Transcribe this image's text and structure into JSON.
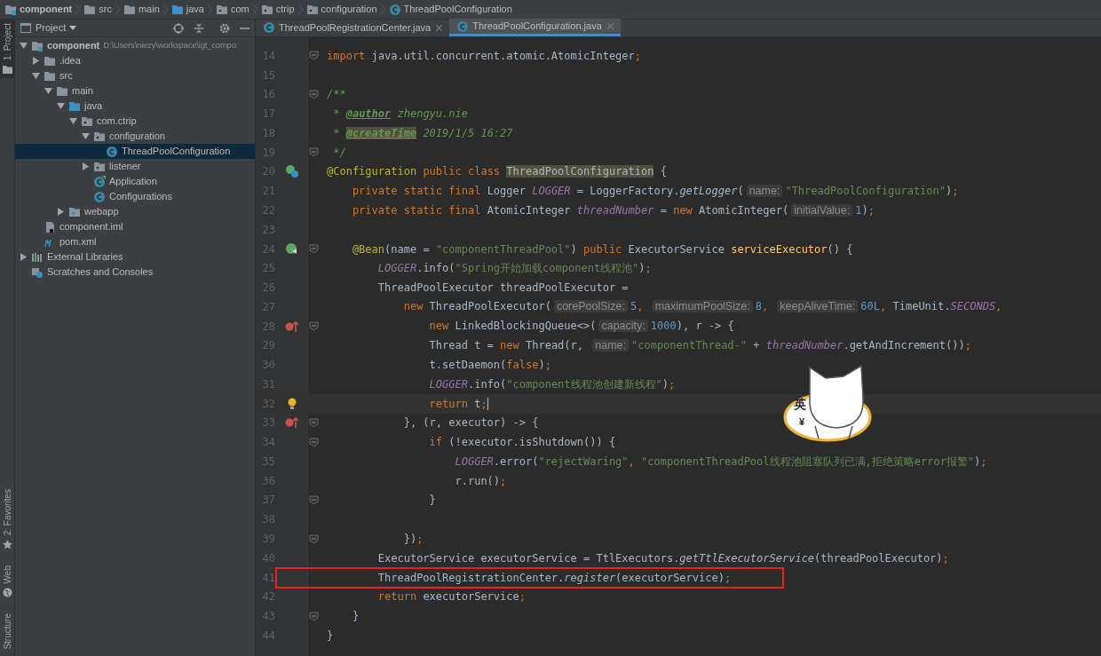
{
  "breadcrumb": [
    {
      "label": "component",
      "kind": "module"
    },
    {
      "label": "src",
      "kind": "folder"
    },
    {
      "label": "main",
      "kind": "folder"
    },
    {
      "label": "java",
      "kind": "source"
    },
    {
      "label": "com",
      "kind": "package"
    },
    {
      "label": "ctrip",
      "kind": "package"
    },
    {
      "label": "configuration",
      "kind": "package"
    },
    {
      "label": "ThreadPoolConfiguration",
      "kind": "class"
    }
  ],
  "tool_strip": {
    "top": [
      {
        "label": "1: Project",
        "kind": "project",
        "selected": true
      }
    ],
    "bottom": [
      {
        "label": "2: Favorites",
        "kind": "favorites",
        "selected": false
      },
      {
        "label": "Web",
        "kind": "web",
        "selected": false
      },
      {
        "label": "Structure",
        "kind": "structure",
        "selected": false
      }
    ]
  },
  "project_panel": {
    "title": "Project",
    "tree": [
      {
        "label": "component",
        "path": "D:\\Users\\niezy\\workspace\\igt_compo",
        "kind": "module",
        "expanded": true,
        "selected": false,
        "children": [
          {
            "label": ".idea",
            "kind": "folder",
            "expanded": false,
            "selected": false
          },
          {
            "label": "src",
            "kind": "folder",
            "expanded": true,
            "selected": false,
            "children": [
              {
                "label": "main",
                "kind": "folder",
                "expanded": true,
                "selected": false,
                "children": [
                  {
                    "label": "java",
                    "kind": "source",
                    "expanded": true,
                    "selected": false,
                    "children": [
                      {
                        "label": "com.ctrip",
                        "kind": "package",
                        "expanded": true,
                        "selected": false,
                        "children": [
                          {
                            "label": "configuration",
                            "kind": "package",
                            "expanded": true,
                            "selected": false,
                            "children": [
                              {
                                "label": "ThreadPoolConfiguration",
                                "kind": "class",
                                "selected": true
                              }
                            ]
                          },
                          {
                            "label": "listener",
                            "kind": "package",
                            "expanded": false,
                            "selected": false
                          },
                          {
                            "label": "Application",
                            "kind": "app",
                            "selected": false
                          },
                          {
                            "label": "Configurations",
                            "kind": "class",
                            "selected": false
                          }
                        ]
                      }
                    ]
                  },
                  {
                    "label": "webapp",
                    "kind": "web",
                    "expanded": false,
                    "selected": false
                  }
                ]
              }
            ]
          },
          {
            "label": "component.iml",
            "kind": "iml",
            "selected": false
          },
          {
            "label": "pom.xml",
            "kind": "maven",
            "selected": false
          }
        ]
      },
      {
        "label": "External Libraries",
        "kind": "libraries",
        "expanded": false,
        "selected": false
      },
      {
        "label": "Scratches and Consoles",
        "kind": "scratches",
        "selected": false
      }
    ]
  },
  "tabs": [
    {
      "label": "ThreadPoolRegistrationCenter.java",
      "selected": false
    },
    {
      "label": "ThreadPoolConfiguration.java",
      "selected": true
    }
  ],
  "code_lines": [
    {
      "number": "14",
      "fold": true,
      "tokens": [
        {
          "kind": "kw",
          "text": "import "
        },
        {
          "kind": "plain",
          "text": "java.util.concurrent.atomic.AtomicInteger"
        },
        {
          "kind": "kw",
          "text": ";"
        }
      ]
    },
    {
      "number": "15"
    },
    {
      "number": "16",
      "fold": true,
      "tokens": [
        {
          "kind": "doc",
          "text": "/**"
        }
      ]
    },
    {
      "number": "17",
      "tokens": [
        {
          "kind": "doc",
          "text": " * "
        },
        {
          "kind": "doctag",
          "text": "@author"
        },
        {
          "kind": "doc",
          "text": " zhengyu.nie"
        }
      ]
    },
    {
      "number": "18",
      "tokens": [
        {
          "kind": "doc",
          "text": " * "
        },
        {
          "kind": "doctag_usage",
          "text": "@createTime"
        },
        {
          "kind": "doc",
          "text": " 2019/1/5 16:27"
        }
      ]
    },
    {
      "number": "19",
      "fold": true,
      "tokens": [
        {
          "kind": "doc",
          "text": " */"
        }
      ]
    },
    {
      "number": "20",
      "gutter_icon": {
        "kind": "bean"
      },
      "tokens": [
        {
          "kind": "ann",
          "text": "@Configuration"
        },
        {
          "kind": "kw",
          "text": " public class "
        },
        {
          "kind": "usage",
          "text": "ThreadPoolConfiguration"
        },
        {
          "kind": "plain",
          "text": " {"
        }
      ]
    },
    {
      "number": "21",
      "tokens": [
        {
          "kind": "kw",
          "text": "    private static final "
        },
        {
          "kind": "plain",
          "text": "Logger "
        },
        {
          "kind": "field",
          "text": "LOGGER"
        },
        {
          "kind": "plain",
          "text": " = LoggerFactory."
        },
        {
          "kind": "static",
          "text": "getLogger"
        },
        {
          "kind": "plain",
          "text": "("
        },
        {
          "kind": "hint",
          "text": "name:"
        },
        {
          "kind": "str",
          "text": "\"ThreadPoolConfiguration\""
        },
        {
          "kind": "plain",
          "text": ")"
        },
        {
          "kind": "kw",
          "text": ";"
        }
      ]
    },
    {
      "number": "22",
      "tokens": [
        {
          "kind": "kw",
          "text": "    private static final "
        },
        {
          "kind": "plain",
          "text": "AtomicInteger "
        },
        {
          "kind": "field",
          "text": "threadNumber"
        },
        {
          "kind": "plain",
          "text": " = "
        },
        {
          "kind": "kw",
          "text": "new "
        },
        {
          "kind": "plain",
          "text": "AtomicInteger("
        },
        {
          "kind": "hint",
          "text": "initialValue:"
        },
        {
          "kind": "num",
          "text": "1"
        },
        {
          "kind": "plain",
          "text": ")"
        },
        {
          "kind": "kw",
          "text": ";"
        }
      ]
    },
    {
      "number": "23"
    },
    {
      "number": "24",
      "fold": true,
      "gutter_icon": {
        "kind": "bean_method"
      },
      "tokens": [
        {
          "kind": "ann",
          "text": "    @Bean"
        },
        {
          "kind": "plain",
          "text": "(name = "
        },
        {
          "kind": "str",
          "text": "\"componentThreadPool\""
        },
        {
          "kind": "plain",
          "text": ") "
        },
        {
          "kind": "kw",
          "text": "public "
        },
        {
          "kind": "plain",
          "text": "ExecutorService "
        },
        {
          "kind": "decl",
          "text": "serviceExecutor"
        },
        {
          "kind": "plain",
          "text": "() {"
        }
      ]
    },
    {
      "number": "25",
      "tokens": [
        {
          "kind": "field",
          "text": "        LOGGER"
        },
        {
          "kind": "plain",
          "text": ".info("
        },
        {
          "kind": "str",
          "text": "\"Spring开始加载component线程池\""
        },
        {
          "kind": "plain",
          "text": ")"
        },
        {
          "kind": "kw",
          "text": ";"
        }
      ]
    },
    {
      "number": "26",
      "tokens": [
        {
          "kind": "plain",
          "text": "        ThreadPoolExecutor threadPoolExecutor ="
        }
      ]
    },
    {
      "number": "27",
      "tokens": [
        {
          "kind": "kw",
          "text": "            new "
        },
        {
          "kind": "plain",
          "text": "ThreadPoolExecutor("
        },
        {
          "kind": "hint",
          "text": "corePoolSize:"
        },
        {
          "kind": "num",
          "text": "5"
        },
        {
          "kind": "kw",
          "text": ", "
        },
        {
          "kind": "hint",
          "text": "maximumPoolSize:"
        },
        {
          "kind": "num",
          "text": "8"
        },
        {
          "kind": "kw",
          "text": ", "
        },
        {
          "kind": "hint",
          "text": "keepAliveTime:"
        },
        {
          "kind": "num",
          "text": "60L"
        },
        {
          "kind": "kw",
          "text": ", "
        },
        {
          "kind": "plain",
          "text": "TimeUnit."
        },
        {
          "kind": "field",
          "text": "SECONDS"
        },
        {
          "kind": "kw",
          "text": ","
        }
      ]
    },
    {
      "number": "28",
      "fold": true,
      "gutter_icon": {
        "kind": "lambda"
      },
      "tokens": [
        {
          "kind": "kw",
          "text": "                new "
        },
        {
          "kind": "plain",
          "text": "LinkedBlockingQueue<>("
        },
        {
          "kind": "hint",
          "text": "capacity:"
        },
        {
          "kind": "num",
          "text": "1000"
        },
        {
          "kind": "plain",
          "text": "), r -> {"
        }
      ]
    },
    {
      "number": "29",
      "tokens": [
        {
          "kind": "plain",
          "text": "                Thread t = "
        },
        {
          "kind": "kw",
          "text": "new "
        },
        {
          "kind": "plain",
          "text": "Thread(r, "
        },
        {
          "kind": "hint",
          "text": "name:"
        },
        {
          "kind": "str",
          "text": "\"componentThread-\""
        },
        {
          "kind": "plain",
          "text": " + "
        },
        {
          "kind": "field",
          "text": "threadNumber"
        },
        {
          "kind": "plain",
          "text": ".getAndIncrement())"
        },
        {
          "kind": "kw",
          "text": ";"
        }
      ]
    },
    {
      "number": "30",
      "tokens": [
        {
          "kind": "plain",
          "text": "                t.setDaemon("
        },
        {
          "kind": "kw",
          "text": "false"
        },
        {
          "kind": "plain",
          "text": ")"
        },
        {
          "kind": "kw",
          "text": ";"
        }
      ]
    },
    {
      "number": "31",
      "tokens": [
        {
          "kind": "field",
          "text": "                LOGGER"
        },
        {
          "kind": "plain",
          "text": ".info("
        },
        {
          "kind": "str",
          "text": "\"component线程池创建新线程\""
        },
        {
          "kind": "plain",
          "text": ")"
        },
        {
          "kind": "kw",
          "text": ";"
        }
      ]
    },
    {
      "number": "32",
      "current": true,
      "gutter_icon": {
        "kind": "bulb"
      },
      "tokens": [
        {
          "kind": "kw",
          "text": "                return "
        },
        {
          "kind": "plain",
          "text": "t"
        },
        {
          "kind": "kw",
          "text": ";"
        }
      ]
    },
    {
      "number": "33",
      "fold": true,
      "gutter_icon": {
        "kind": "lambda"
      },
      "tokens": [
        {
          "kind": "plain",
          "text": "            }, (r, executor) -> {"
        }
      ]
    },
    {
      "number": "34",
      "fold": true,
      "tokens": [
        {
          "kind": "kw",
          "text": "                if "
        },
        {
          "kind": "plain",
          "text": "(!executor.isShutdown()) {"
        }
      ]
    },
    {
      "number": "35",
      "tokens": [
        {
          "kind": "field",
          "text": "                    LOGGER"
        },
        {
          "kind": "plain",
          "text": ".error("
        },
        {
          "kind": "str",
          "text": "\"rejectWaring\""
        },
        {
          "kind": "kw",
          "text": ", "
        },
        {
          "kind": "str",
          "text": "\"componentThreadPool线程池阻塞队列已满,拒绝策略error报警\""
        },
        {
          "kind": "plain",
          "text": ")"
        },
        {
          "kind": "kw",
          "text": ";"
        }
      ]
    },
    {
      "number": "36",
      "tokens": [
        {
          "kind": "plain",
          "text": "                    r.run()"
        },
        {
          "kind": "kw",
          "text": ";"
        }
      ]
    },
    {
      "number": "37",
      "fold": true,
      "tokens": [
        {
          "kind": "plain",
          "text": "                }"
        }
      ]
    },
    {
      "number": "38"
    },
    {
      "number": "39",
      "fold": true,
      "tokens": [
        {
          "kind": "plain",
          "text": "            })"
        },
        {
          "kind": "kw",
          "text": ";"
        }
      ]
    },
    {
      "number": "40",
      "tokens": [
        {
          "kind": "plain",
          "text": "        ExecutorService executorService = TtlExecutors."
        },
        {
          "kind": "static",
          "text": "getTtlExecutorService"
        },
        {
          "kind": "plain",
          "text": "(threadPoolExecutor)"
        },
        {
          "kind": "kw",
          "text": ";"
        }
      ]
    },
    {
      "number": "41",
      "boxed": true,
      "tokens": [
        {
          "kind": "plain",
          "text": "        ThreadPoolRegistrationCenter."
        },
        {
          "kind": "static",
          "text": "register"
        },
        {
          "kind": "plain",
          "text": "(executorService)"
        },
        {
          "kind": "kw",
          "text": ";"
        }
      ]
    },
    {
      "number": "42",
      "tokens": [
        {
          "kind": "kw",
          "text": "        return "
        },
        {
          "kind": "plain",
          "text": "executorService"
        },
        {
          "kind": "kw",
          "text": ";"
        }
      ]
    },
    {
      "number": "43",
      "fold": true,
      "tokens": [
        {
          "kind": "plain",
          "text": "    }"
        }
      ]
    },
    {
      "number": "44",
      "tokens": [
        {
          "kind": "plain",
          "text": "}"
        }
      ]
    }
  ],
  "ime_indicator": {
    "label": "英",
    "symbol": "¥"
  }
}
